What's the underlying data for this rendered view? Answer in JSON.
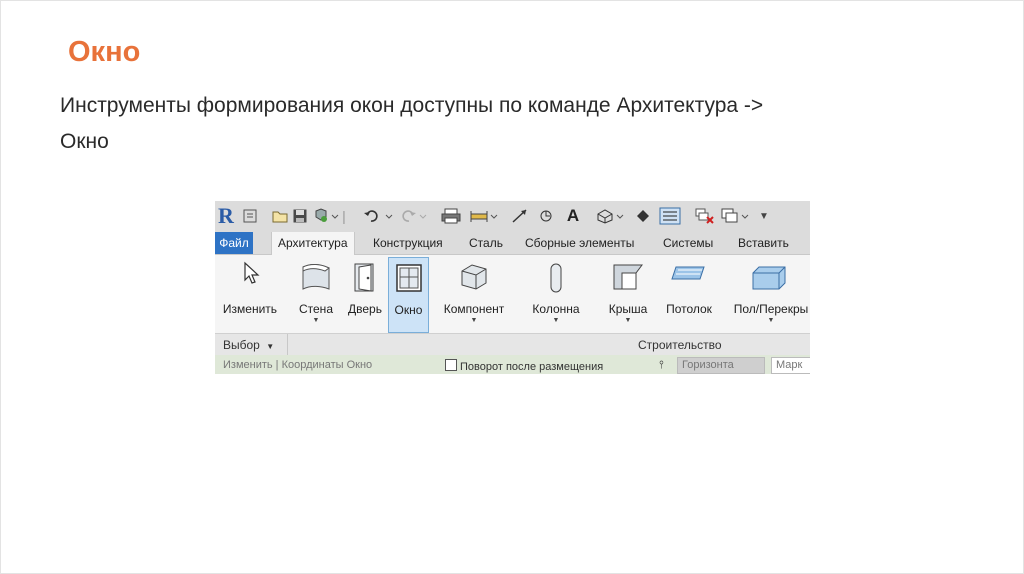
{
  "slide": {
    "title": "Окно",
    "body_line1": "Инструменты формирования окон доступны по команде Архитектура ->",
    "body_line2": "Окно"
  },
  "screenshot": {
    "app_logo": "R",
    "tabs": [
      {
        "label": "Файл"
      },
      {
        "label": "Архитектура"
      },
      {
        "label": "Конструкция"
      },
      {
        "label": "Сталь"
      },
      {
        "label": "Сборные элементы"
      },
      {
        "label": "Системы"
      },
      {
        "label": "Вставить"
      }
    ],
    "tools": [
      {
        "label": "Изменить",
        "icon": "cursor-icon"
      },
      {
        "label": "Стена",
        "icon": "wall-icon"
      },
      {
        "label": "Дверь",
        "icon": "door-icon"
      },
      {
        "label": "Окно",
        "icon": "window-icon",
        "selected": true
      },
      {
        "label": "Компонент",
        "icon": "component-icon"
      },
      {
        "label": "Колонна",
        "icon": "column-icon"
      },
      {
        "label": "Крыша",
        "icon": "roof-icon"
      },
      {
        "label": "Потолок",
        "icon": "ceiling-icon"
      },
      {
        "label": "Пол/Перекры",
        "icon": "floor-icon"
      }
    ],
    "groups": {
      "select": "Выбор",
      "build": "Строительство"
    },
    "options_bar": {
      "context": "Изменить | Координаты Окно",
      "rotate_checkbox": "Поворот после размещения",
      "orientation": "Горизонта",
      "tag": "Марк"
    }
  }
}
